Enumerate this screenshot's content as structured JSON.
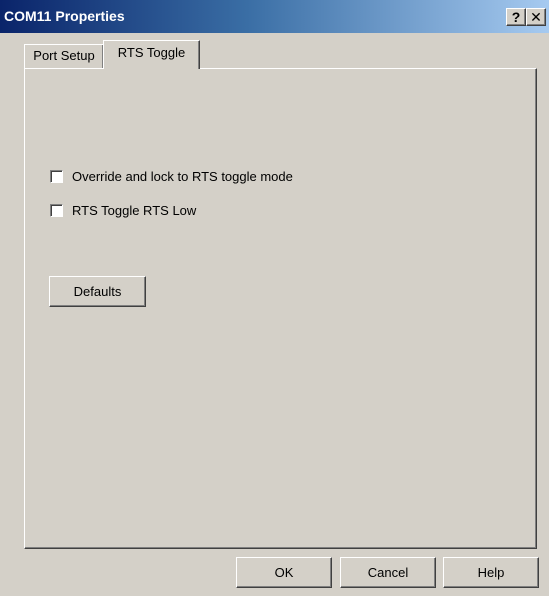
{
  "window": {
    "title": "COM11 Properties",
    "help_button": "?",
    "close_button": "✕"
  },
  "tabs": [
    {
      "label": "Port Setup",
      "selected": false
    },
    {
      "label": "RTS Toggle",
      "selected": true
    }
  ],
  "panel": {
    "override_checkbox": {
      "label": "Override and lock to RTS toggle mode",
      "checked": false
    },
    "rts_low_checkbox": {
      "label": "RTS Toggle RTS Low",
      "checked": false
    },
    "defaults_button": "Defaults"
  },
  "buttons": {
    "ok": "OK",
    "cancel": "Cancel",
    "help": "Help"
  }
}
